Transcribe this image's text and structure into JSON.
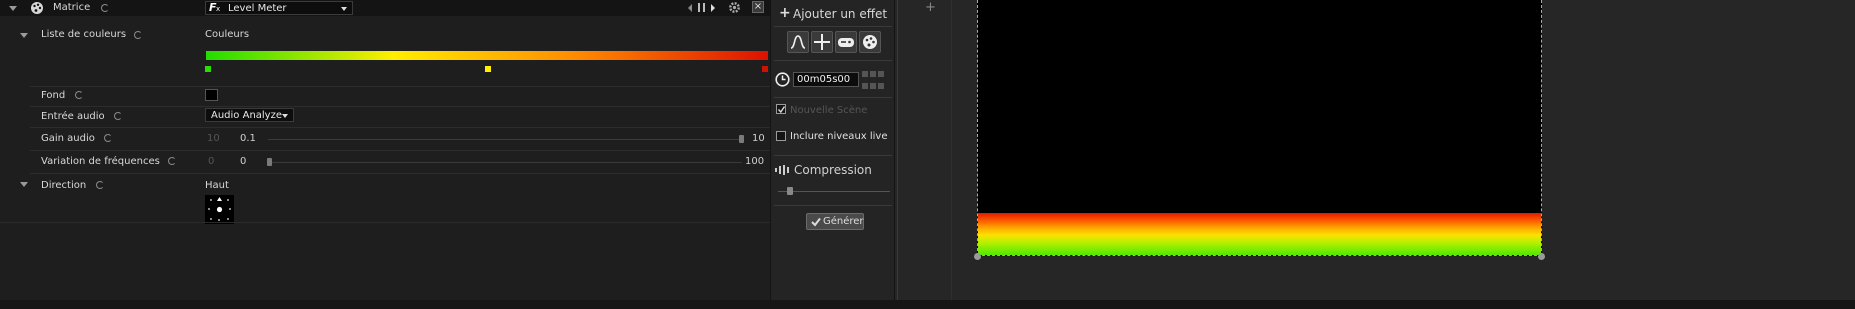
{
  "header": {
    "title": "Matrice",
    "effect_select": "Level Meter"
  },
  "rows": {
    "colors": {
      "label": "Liste de couleurs",
      "value_label": "Couleurs"
    },
    "fond": {
      "label": "Fond"
    },
    "audio_input": {
      "label": "Entrée audio",
      "value": "Audio Analyze"
    },
    "gain": {
      "label": "Gain audio",
      "min": "10",
      "value": "0.1",
      "max": "10"
    },
    "freq": {
      "label": "Variation de fréquences",
      "min": "0",
      "value": "0",
      "max": "100"
    },
    "direction": {
      "label": "Direction",
      "value": "Haut"
    }
  },
  "gradient_colors": [
    "#22dd00",
    "#ffee00",
    "#ff8800",
    "#dd1100"
  ],
  "mid": {
    "add_effect": "Ajouter un effet",
    "time": "00m05s00",
    "new_scene": "Nouvelle Scène",
    "include_live": "Inclure niveaux live",
    "compression": "Compression",
    "generate": "Générer"
  }
}
